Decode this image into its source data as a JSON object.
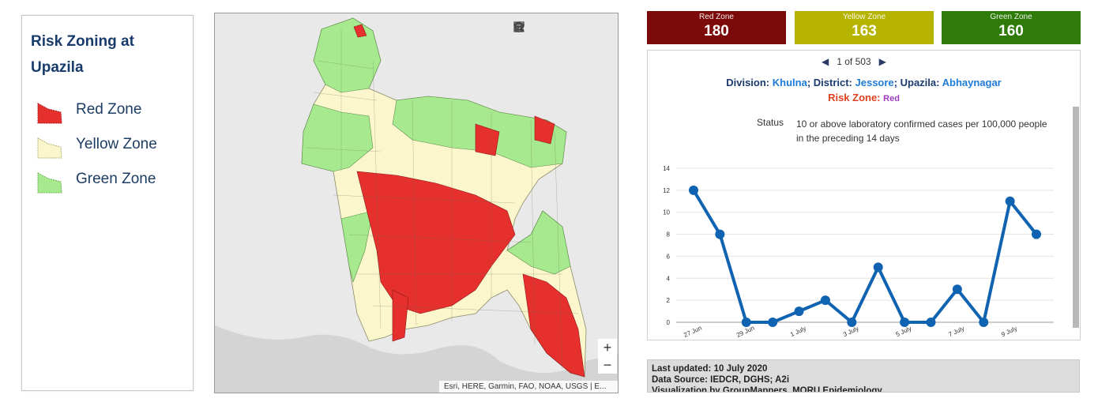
{
  "legend": {
    "title": "Risk Zoning at Upazila",
    "items": [
      {
        "label": "Red Zone",
        "color": "#e5302e"
      },
      {
        "label": "Yellow Zone",
        "color": "#fbf6cc"
      },
      {
        "label": "Green Zone",
        "color": "#a6e98f"
      }
    ]
  },
  "map": {
    "tools": [
      "search-icon",
      "home-icon",
      "list-icon",
      "layers-icon",
      "qr-icon"
    ],
    "zoom_in": "+",
    "zoom_out": "−",
    "attribution": "Esri, HERE, Garmin, FAO, NOAA, USGS | E..."
  },
  "zone_counts": [
    {
      "name": "Red Zone",
      "value": "180",
      "color": "#7d0a0a"
    },
    {
      "name": "Yellow Zone",
      "value": "163",
      "color": "#b6b400"
    },
    {
      "name": "Green Zone",
      "value": "160",
      "color": "#2e7b0a"
    }
  ],
  "popup": {
    "pager": "1 of 503",
    "division_label": "Division:",
    "division": "Khulna",
    "district_label": "; District:",
    "district": "Jessore",
    "upazila_label": "; Upazila:",
    "upazila": "Abhaynagar",
    "risk_label": "Risk Zone:",
    "risk": "Red",
    "status_label": "Status",
    "status_text": "10 or above laboratory confirmed cases per 100,000 people in the preceding 14 days"
  },
  "chart_data": {
    "type": "line",
    "x": [
      "27 Jun",
      "28 Jun",
      "29 Jun",
      "30 Jun",
      "1 July",
      "2 July",
      "3 July",
      "4 July",
      "5 July",
      "6 July",
      "7 July",
      "8 July",
      "9 July",
      "10 July"
    ],
    "tick_labels": [
      "27 Jun",
      "29 Jun",
      "1 July",
      "3 July",
      "5 July",
      "7 July",
      "9 July"
    ],
    "values": [
      12,
      8,
      0,
      0,
      1,
      2,
      0,
      5,
      0,
      0,
      3,
      0,
      11,
      8
    ],
    "ylim": [
      0,
      14
    ],
    "yticks": [
      0,
      2,
      4,
      6,
      8,
      10,
      12,
      14
    ],
    "color": "#0f63b0",
    "grid": true
  },
  "footer": {
    "updated": "Last updated: 10 July 2020",
    "source": "Data Source: IEDCR, DGHS; A2i",
    "viz": "Visualization by GroupMappers, MORU Epidemiology"
  }
}
